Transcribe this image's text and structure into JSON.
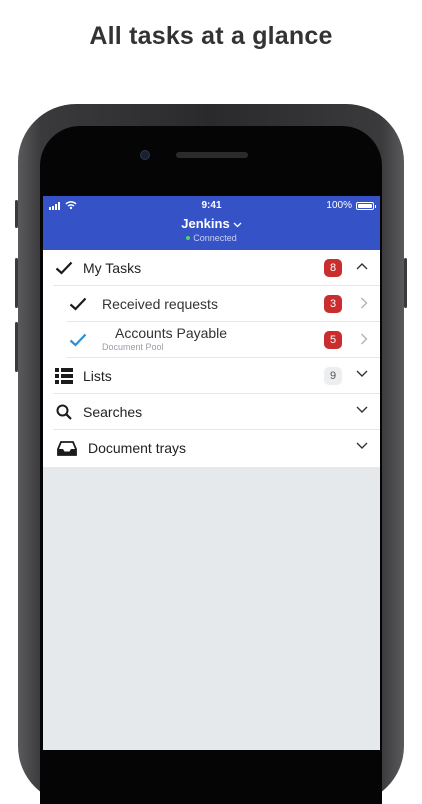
{
  "headline": "All tasks at a glance",
  "status_bar": {
    "time": "9:41",
    "battery": "100%"
  },
  "nav": {
    "title": "Jenkins",
    "subtitle": "Connected"
  },
  "sections": {
    "my_tasks": {
      "label": "My Tasks",
      "count": "8"
    },
    "received": {
      "label": "Received requests",
      "count": "3"
    },
    "accounts": {
      "label": "Accounts Payable",
      "secondary": "Document Pool",
      "count": "5"
    },
    "lists": {
      "label": "Lists",
      "count": "9"
    },
    "searches": {
      "label": "Searches"
    },
    "trays": {
      "label": "Document trays"
    }
  },
  "colors": {
    "header": "#3553c6",
    "badge": "#c92d2d",
    "accent_check": "#2a8fd6"
  }
}
